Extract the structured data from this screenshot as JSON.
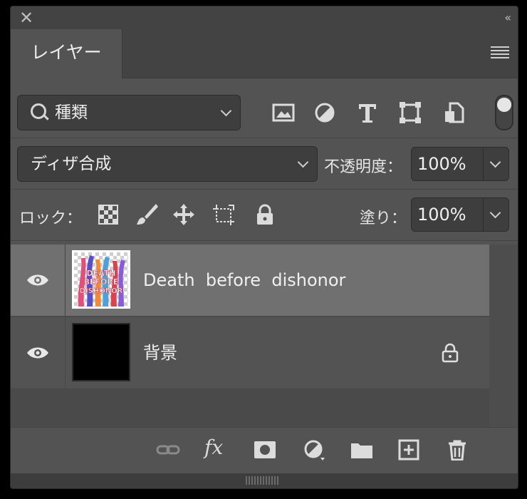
{
  "panel": {
    "close_glyph": "✕",
    "collapse_glyph": "‹‹"
  },
  "tab": {
    "label": "レイヤー"
  },
  "filter": {
    "kind_label": "種類",
    "tools": [
      "image-filter-icon",
      "adjustment-filter-icon",
      "type-filter-icon",
      "shape-filter-icon",
      "smart-object-filter-icon"
    ],
    "toggle_on": true
  },
  "blend": {
    "mode": "ディザ合成",
    "opacity_label": "不透明度：",
    "opacity_value": "100%"
  },
  "lock": {
    "label": "ロック：",
    "icons": [
      "lock-transparent-pixels-icon",
      "lock-image-pixels-icon",
      "lock-position-icon",
      "lock-artboard-icon",
      "lock-all-icon"
    ],
    "fill_label": "塗り：",
    "fill_value": "100%"
  },
  "layers": [
    {
      "name": "Death  before  dishonor",
      "visible": true,
      "selected": true,
      "locked": false,
      "thumb_text": [
        "DEATH",
        "BEFORE",
        "DISHONOR"
      ]
    },
    {
      "name": "背景",
      "visible": true,
      "selected": false,
      "locked": true
    }
  ],
  "footer": {
    "icons": [
      "link-layers-icon",
      "fx-icon",
      "add-mask-icon",
      "adjustment-layer-icon",
      "new-group-icon",
      "new-layer-icon",
      "delete-layer-icon"
    ],
    "fx_text": "fx"
  },
  "colors": {
    "panel_bg": "#535353",
    "selected_row": "#707070",
    "field_bg": "#3e3e3e"
  }
}
